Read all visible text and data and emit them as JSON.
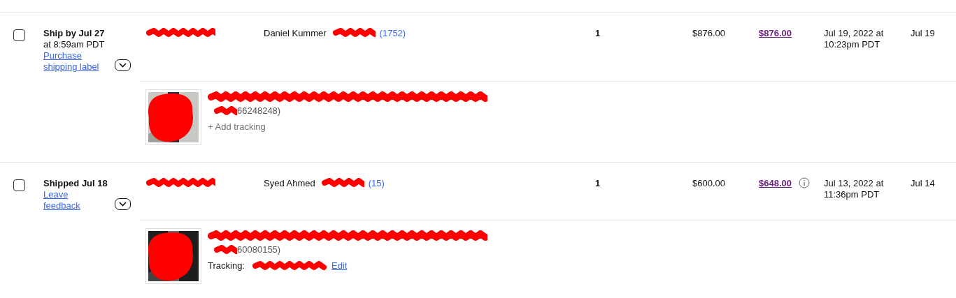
{
  "orders": [
    {
      "checked": false,
      "status": "Ship by Jul 27",
      "status_detail": "at 8:59am PDT",
      "action_link": "Purchase shipping label",
      "buyer_name": "Daniel Kummer",
      "feedback_score": "(1752)",
      "quantity": "1",
      "price": "$876.00",
      "total": "$876.00",
      "total_info": false,
      "sold_date": "Jul 19, 2022 at 10:23pm PDT",
      "column_9": "Jul 19",
      "item": {
        "item_number": "66248248)",
        "tracking": {
          "kind": "add",
          "label": "+ Add tracking"
        }
      }
    },
    {
      "checked": false,
      "status": "Shipped Jul 18",
      "action_link": "Leave feedback",
      "buyer_name": "Syed Ahmed",
      "feedback_score": "(15)",
      "quantity": "1",
      "price": "$600.00",
      "total": "$648.00",
      "total_info": true,
      "sold_date": "Jul 13, 2022 at 11:36pm PDT",
      "column_9": "Jul 14",
      "item": {
        "item_number": "60080155)",
        "tracking": {
          "kind": "number",
          "label": "Tracking:",
          "edit": "Edit"
        }
      }
    }
  ]
}
